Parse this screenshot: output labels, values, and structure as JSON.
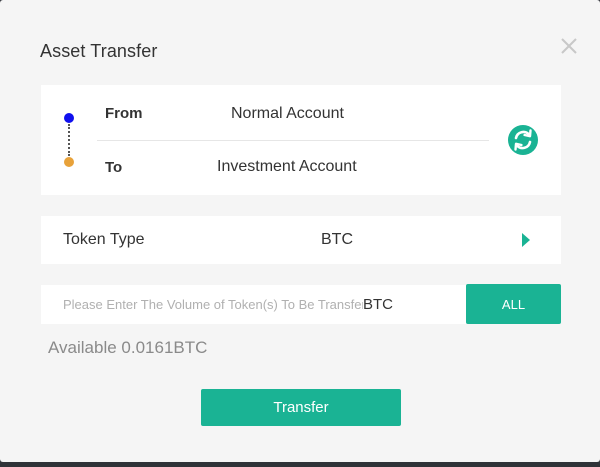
{
  "dialog": {
    "title": "Asset Transfer",
    "close_icon": "close-icon"
  },
  "transfer": {
    "from_label": "From",
    "from_value": "Normal Account",
    "to_label": "To",
    "to_value": "Investment Account",
    "swap_icon": "swap-icon",
    "from_color": "#1010ee",
    "to_color": "#e8a23a"
  },
  "token": {
    "label": "Token Type",
    "value": "BTC",
    "arrow_icon": "caret-right-icon"
  },
  "amount": {
    "placeholder": "Please Enter The Volume of Token(s) To Be Transferred",
    "value": "",
    "unit": "BTC",
    "all_label": "ALL"
  },
  "available": {
    "text": "Available 0.0161BTC"
  },
  "actions": {
    "transfer_label": "Transfer"
  },
  "colors": {
    "accent": "#1ab394"
  }
}
